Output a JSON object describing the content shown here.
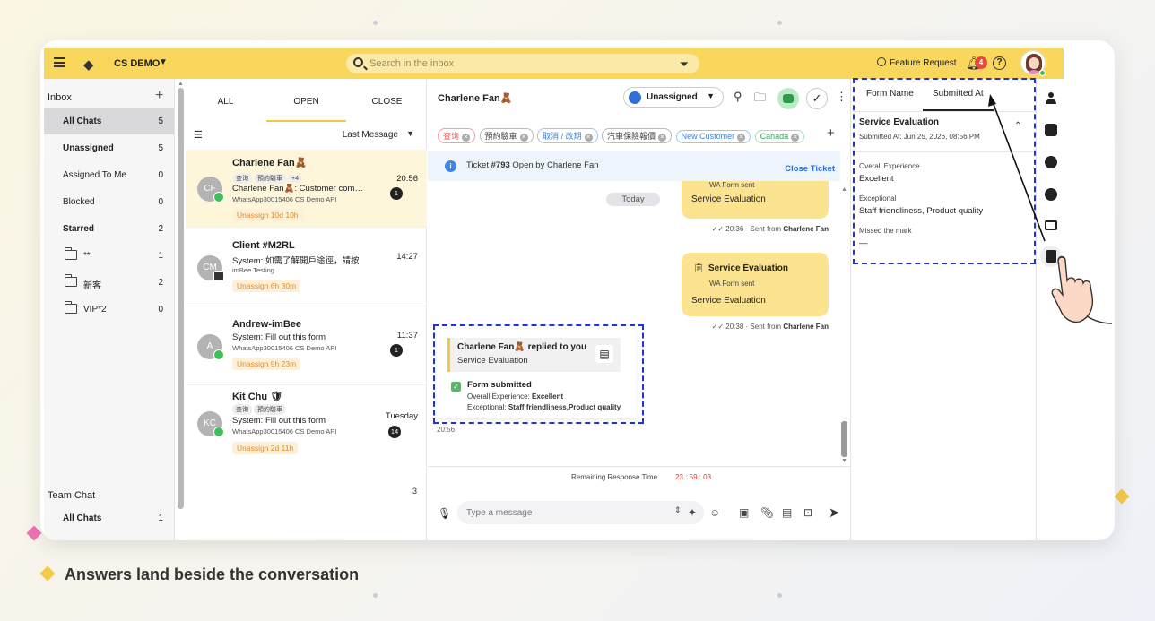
{
  "colors": {
    "topbar": "#f9d65c",
    "accent_yellow": "#f3c93d",
    "bubble": "#fce38f",
    "highlight_dash": "#2034d8",
    "unassign_pill_text": "#e58a2a",
    "close_ticket": "#2f6fd6",
    "response_time": "#d83a3a"
  },
  "topbar": {
    "menu_icon": "hamburger-icon",
    "logo_icon": "diamond-logo-icon",
    "workspace": "CS DEMO",
    "search_placeholder": "Search in the inbox",
    "feature_request": "Feature Request",
    "notifications_count": "4"
  },
  "inbox": {
    "title": "Inbox",
    "items": [
      {
        "label": "All Chats",
        "count": "5"
      },
      {
        "label": "Unassigned",
        "count": "5"
      },
      {
        "label": "Assigned To Me",
        "count": "0"
      },
      {
        "label": "Blocked",
        "count": "0"
      },
      {
        "label": "Starred",
        "count": "2"
      }
    ],
    "folders": [
      {
        "label": "**",
        "count": "1"
      },
      {
        "label": "新客",
        "count": "2"
      },
      {
        "label": "VIP*2",
        "count": "0"
      }
    ],
    "team_chat_title": "Team Chat",
    "team_items": [
      {
        "label": "All Chats",
        "count": "1"
      }
    ]
  },
  "chat_list": {
    "tabs": [
      "ALL",
      "OPEN",
      "CLOSE"
    ],
    "sort_label": "Last Message",
    "conversations": [
      {
        "initials": "CF",
        "name": "Charlene Fan",
        "name_emoji": "🧸",
        "tags": [
          "查询",
          "預約驗車",
          "+4"
        ],
        "preview": "Charlene Fan🧸: Customer completed",
        "source": "WhatsApp30015406 CS Demo API",
        "pill": "Unassign 10d 10h",
        "time": "20:56",
        "unread": "1"
      },
      {
        "initials": "CM",
        "name": "Client #M2RL",
        "name_emoji": "",
        "tags": [],
        "preview": "System: 如需了解開戶途徑，請按",
        "source": "imBee Testing",
        "pill": "Unassign 6h 30m",
        "time": "14:27",
        "unread": ""
      },
      {
        "initials": "A",
        "name": "Andrew-imBee",
        "name_emoji": "",
        "tags": [],
        "preview": "System: Fill out this form",
        "source": "WhatsApp30015406 CS Demo API",
        "pill": "Unassign 9h 23m",
        "time": "11:37",
        "unread": "1"
      },
      {
        "initials": "KC",
        "name": "Kit Chu",
        "name_emoji": "🛡",
        "tags": [
          "查询",
          "預約驗車"
        ],
        "preview": "System: Fill out this form",
        "source": "WhatsApp30015406 CS Demo API",
        "pill": "Unassign 2d 11h",
        "time": "Tuesday",
        "unread": "14"
      }
    ],
    "total": "3"
  },
  "conversation": {
    "contact_name": "Charlene Fan🧸",
    "assignee": "Unassigned",
    "tags": [
      {
        "label": "查询",
        "style": "red"
      },
      {
        "label": "預約驗車",
        "style": "grey"
      },
      {
        "label": "取消 / 改期",
        "style": "blue"
      },
      {
        "label": "汽車保險報價",
        "style": "grey"
      },
      {
        "label": "New Customer",
        "style": "blue"
      },
      {
        "label": "Canada",
        "style": "green"
      }
    ],
    "ticket": {
      "text_prefix": "Ticket ",
      "number": "#793",
      "text_suffix": " Open by Charlene Fan",
      "close_label": "Close Ticket"
    },
    "today_label": "Today",
    "messages": [
      {
        "sent_label": "WA Form sent",
        "body": "Service Evaluation",
        "time": "20:36",
        "sent_from_prefix": "· Sent from ",
        "sender": "Charlene Fan"
      },
      {
        "title": "Service Evaluation",
        "sent_label": "WA Form sent",
        "body": "Service Evaluation",
        "time": "20:38",
        "sent_from_prefix": "· Sent from ",
        "sender": "Charlene Fan"
      }
    ],
    "reply": {
      "title_name": "Charlene Fan🧸",
      "title_rest": " replied to you",
      "subtitle": "Service Evaluation",
      "status": "Form submitted",
      "line1_label": "Overall Experience: ",
      "line1_value": "Excellent",
      "line2_label": "Exceptional: ",
      "line2_value": "Staff friendliness,Product quality",
      "time": "20:56"
    },
    "response_time_label": "Remaining Response Time",
    "response_time_value": "23 : 59 : 03",
    "compose_placeholder": "Type a message"
  },
  "side_panel": {
    "tabs": [
      "Form Name",
      "Submitted At"
    ],
    "form_title": "Service Evaluation",
    "submitted_at": "Submitted At: Jun 25, 2026, 08:56 PM",
    "fields": [
      {
        "label": "Overall Experience",
        "value": "Excellent"
      },
      {
        "label": "Exceptional",
        "value": "Staff friendliness, Product quality"
      },
      {
        "label": "Missed the mark",
        "value": "—"
      }
    ]
  },
  "rail_icons": [
    "person-icon",
    "chat-bubbles-icon",
    "clock-icon",
    "bolt-icon",
    "card-icon",
    "clipboard-form-icon"
  ],
  "caption": "Answers land beside the conversation"
}
